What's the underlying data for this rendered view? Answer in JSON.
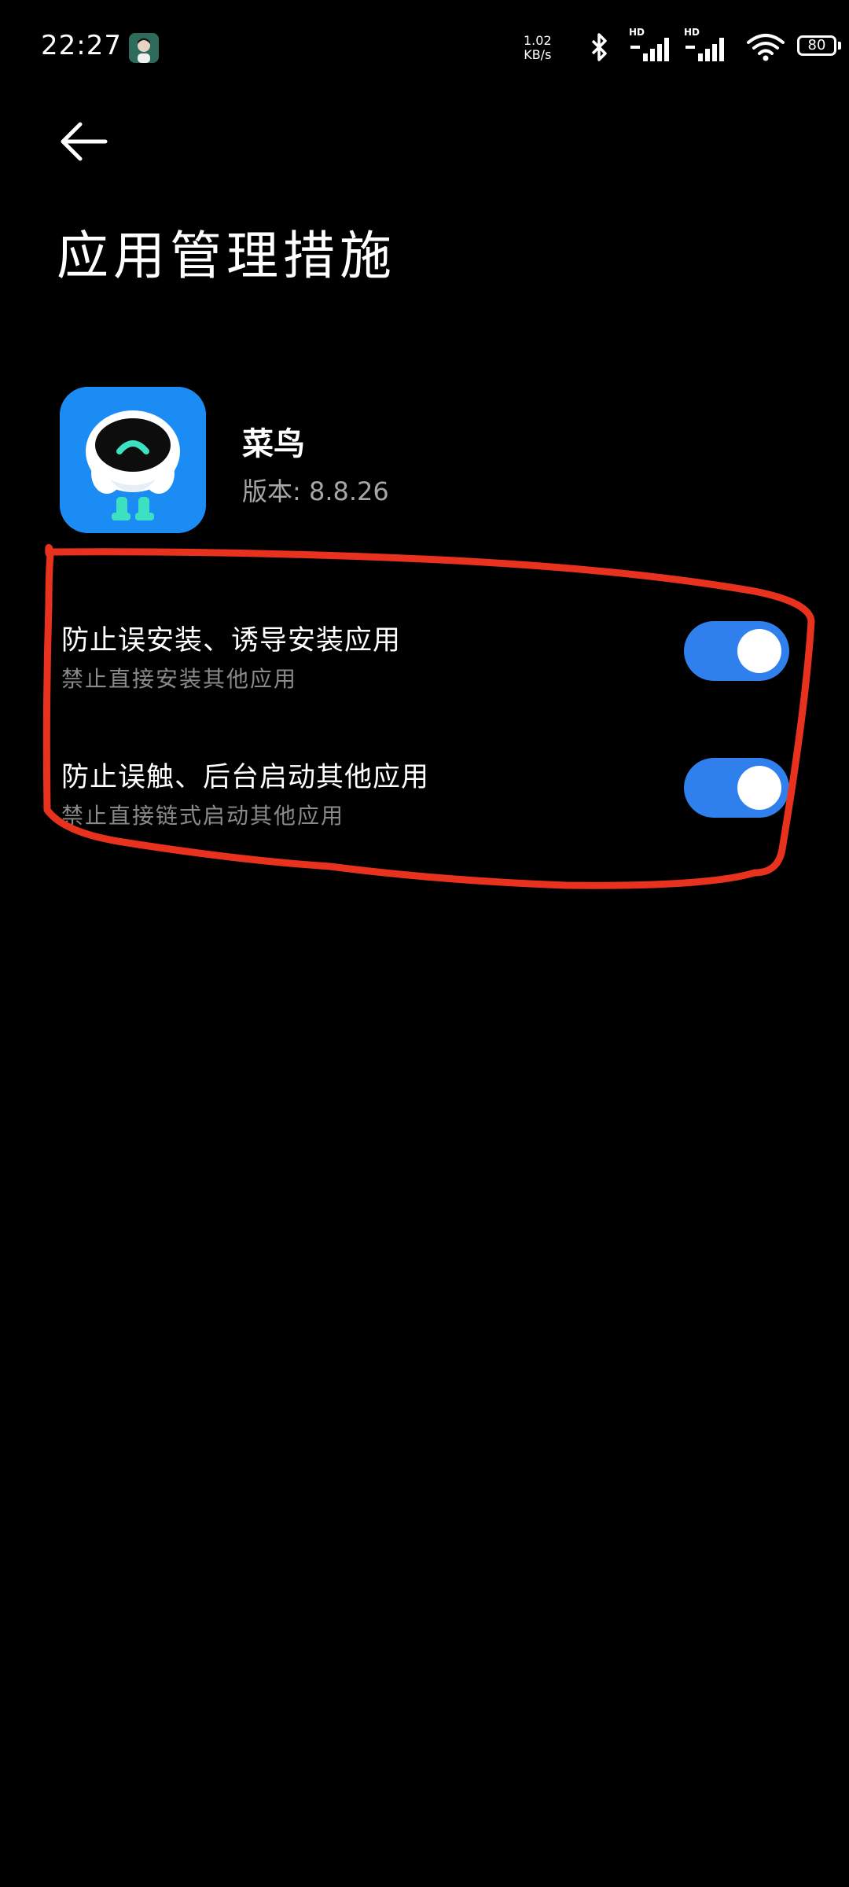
{
  "status_bar": {
    "time": "22:27",
    "net_speed_value": "1.02",
    "net_speed_unit": "KB/s",
    "signal1_label": "HD",
    "signal2_label": "HD",
    "battery": "80"
  },
  "header": {
    "back_icon": "arrow-left-icon",
    "title": "应用管理措施"
  },
  "app": {
    "name": "菜鸟",
    "version": "版本: 8.8.26",
    "icon": "cainiao-robot-icon"
  },
  "settings": [
    {
      "title": "防止误安装、诱导安装应用",
      "subtitle": "禁止直接安装其他应用",
      "enabled": true
    },
    {
      "title": "防止误触、后台启动其他应用",
      "subtitle": "禁止直接链式启动其他应用",
      "enabled": true
    }
  ],
  "colors": {
    "background": "#000000",
    "accent": "#2f80ed",
    "annotation": "#e8321e",
    "app_icon_bg": "#1c8cf5",
    "subtitle": "#8a8a8a"
  }
}
